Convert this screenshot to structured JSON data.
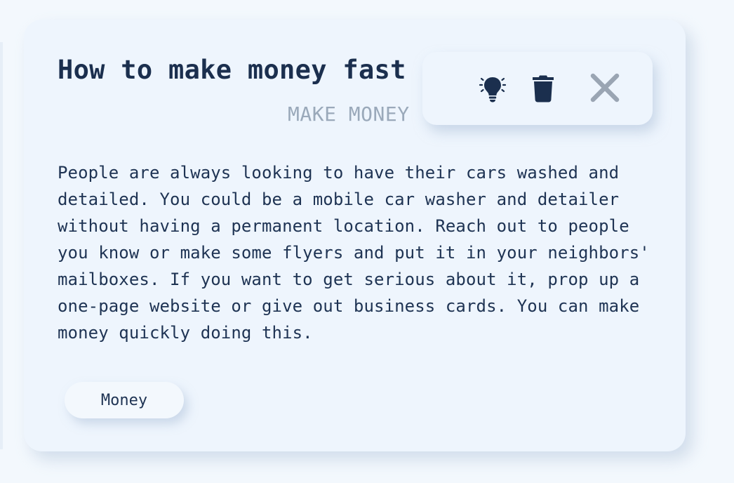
{
  "card": {
    "title": "How to make money fast",
    "category": "MAKE MONEY",
    "body": "People are always looking to have their cars washed and detailed. You could be a mobile car washer and detailer without having a permanent location. Reach out to people you know or make some flyers and put it in your neighbors' mailboxes. If you want to get serious about it, prop up a one-page website or give out business cards. You can make money quickly doing this.",
    "tags": [
      "Money"
    ]
  },
  "toolbar": {
    "icons": [
      "lightbulb-icon",
      "trash-icon",
      "close-icon"
    ]
  },
  "colors": {
    "background": "#f3f8fd",
    "card": "#eef5fd",
    "text_dark": "#1b2f4e",
    "text_muted": "#9aa9ba",
    "close_icon": "#9aa5b3"
  }
}
